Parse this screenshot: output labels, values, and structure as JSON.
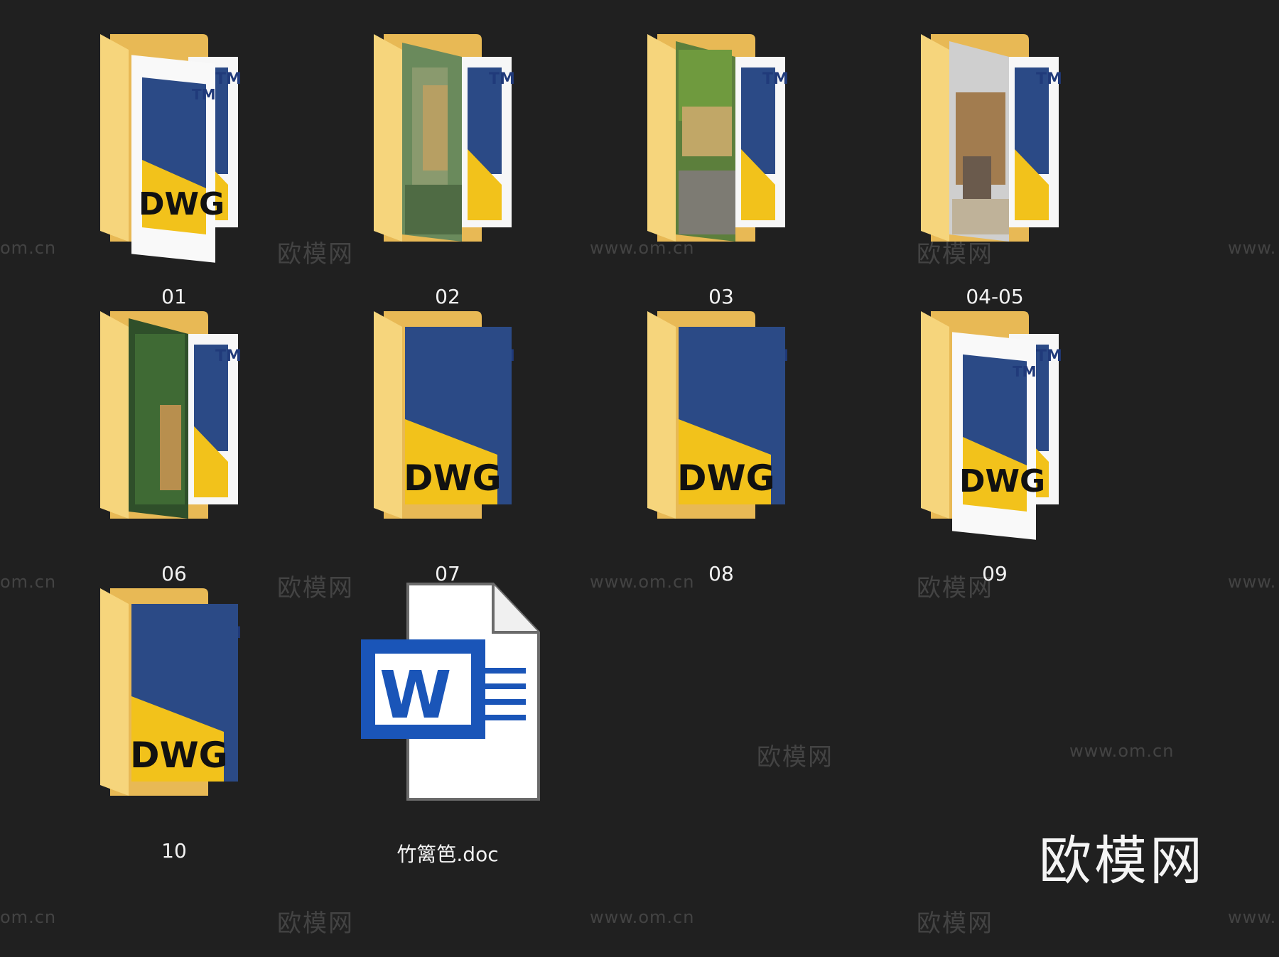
{
  "items": [
    {
      "name": "01",
      "kind": "folder",
      "preview": "dwg"
    },
    {
      "name": "02",
      "kind": "folder",
      "preview": "photo-garden"
    },
    {
      "name": "03",
      "kind": "folder",
      "preview": "photo-fence-grass"
    },
    {
      "name": "04-05",
      "kind": "folder",
      "preview": "photo-fence-wood"
    },
    {
      "name": "06",
      "kind": "folder",
      "preview": "photo-forest"
    },
    {
      "name": "07",
      "kind": "folder",
      "preview": "dwg"
    },
    {
      "name": "08",
      "kind": "folder",
      "preview": "dwg"
    },
    {
      "name": "09",
      "kind": "folder",
      "preview": "dwg"
    },
    {
      "name": "10",
      "kind": "folder",
      "preview": "dwg"
    },
    {
      "name": "竹篱笆.doc",
      "kind": "word-doc",
      "preview": "word-icon"
    }
  ],
  "watermark": {
    "url_text": "www.om.cn",
    "url_partial_left": "om.cn",
    "url_partial_right": "www.",
    "logo_text": "欧模网"
  },
  "brand_text": "欧模网",
  "dwg_text": "DWG",
  "tm_text": "TM",
  "colors": {
    "background": "#202020",
    "folder": "#f6d57c",
    "folder_dark": "#e3b54f",
    "dwg_yellow": "#f2c21b",
    "dwg_blue": "#2b4a86",
    "word_blue": "#1a55b8"
  }
}
